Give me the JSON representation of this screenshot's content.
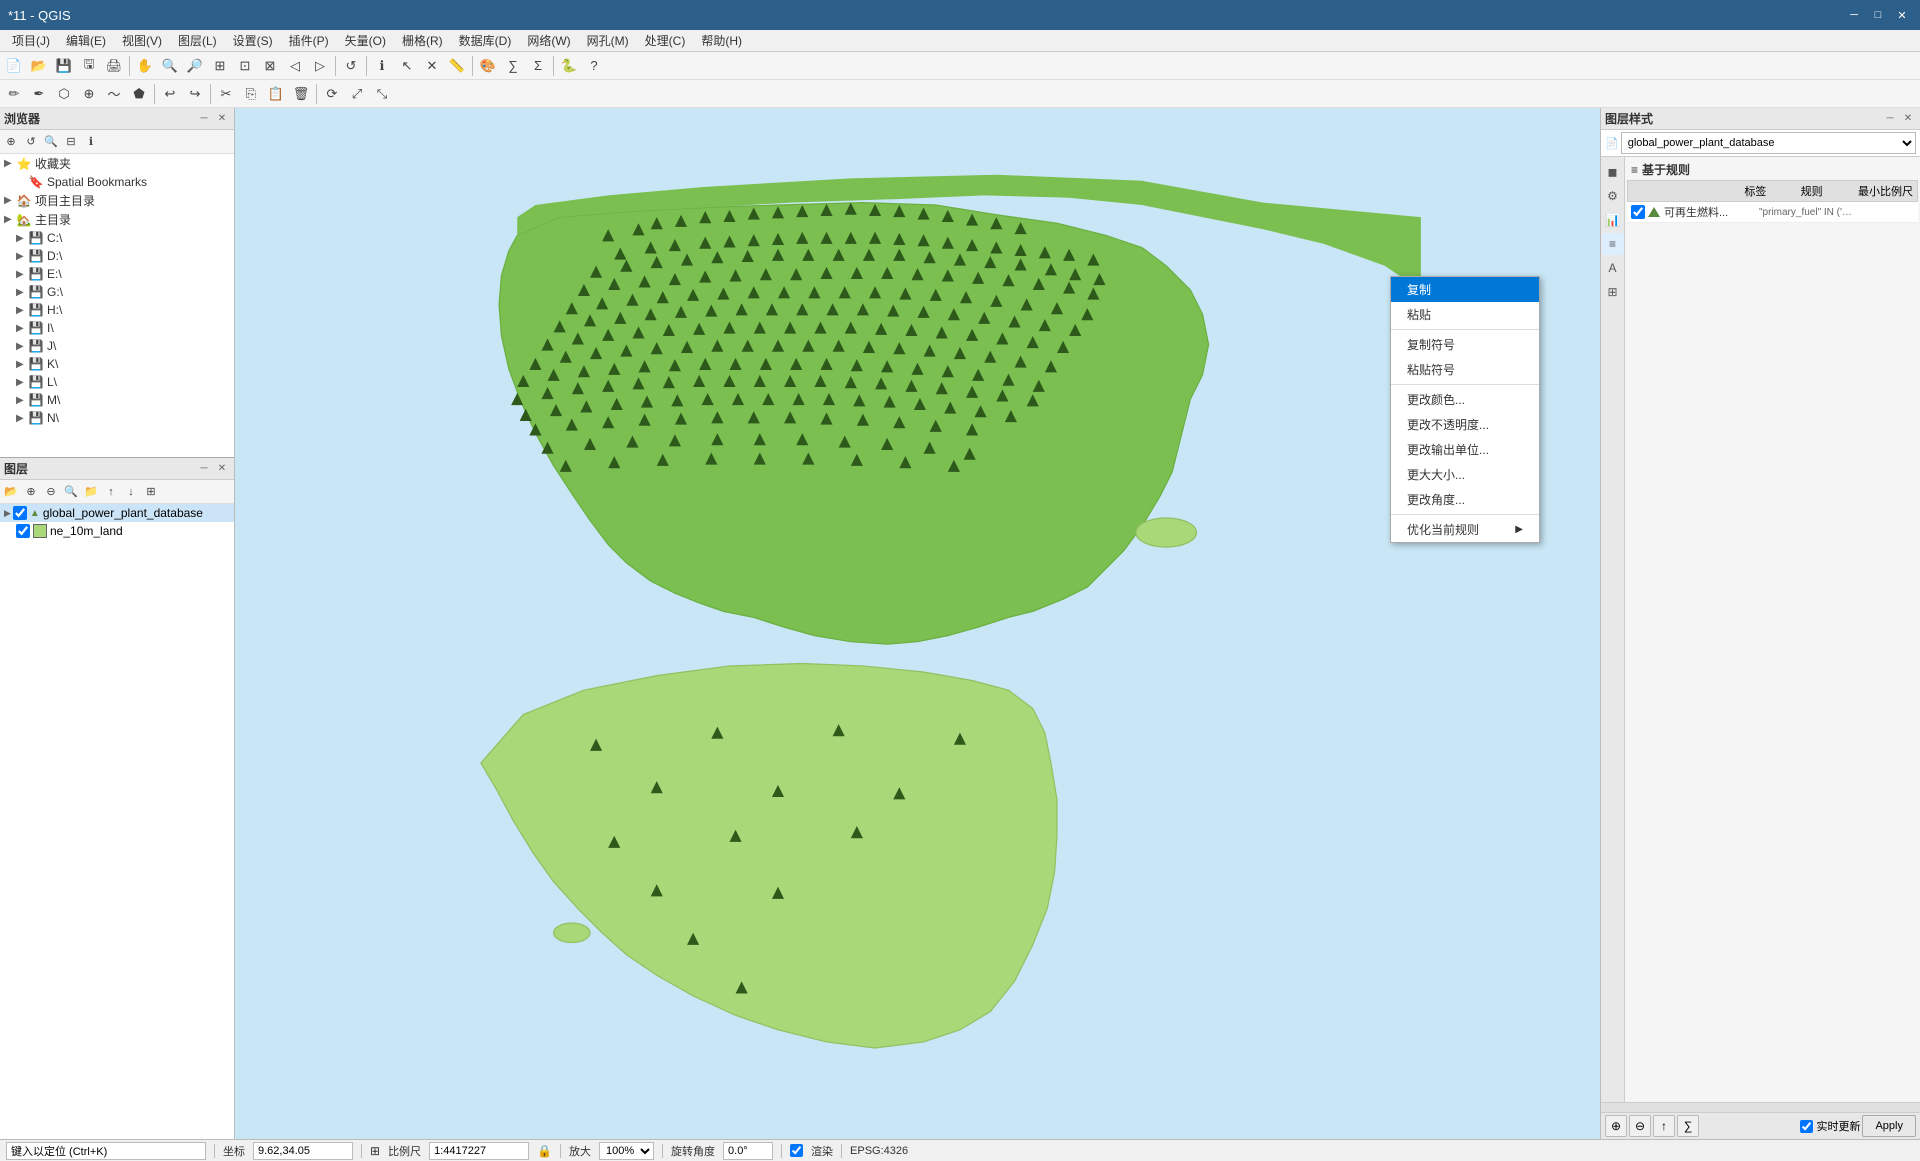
{
  "titlebar": {
    "title": "*11 - QGIS",
    "controls": [
      "minimize",
      "maximize",
      "close"
    ]
  },
  "menubar": {
    "items": [
      "项目(J)",
      "编辑(E)",
      "视图(V)",
      "图层(L)",
      "设置(S)",
      "插件(P)",
      "矢量(O)",
      "栅格(R)",
      "数据库(D)",
      "网络(W)",
      "网孔(M)",
      "处理(C)",
      "帮助(H)"
    ]
  },
  "browser_panel": {
    "title": "浏览器",
    "items": [
      {
        "label": "收藏夹",
        "indent": 0,
        "expandable": true
      },
      {
        "label": "Spatial Bookmarks",
        "indent": 1,
        "expandable": false
      },
      {
        "label": "项目主目录",
        "indent": 0,
        "expandable": true
      },
      {
        "label": "主目录",
        "indent": 0,
        "expandable": true
      },
      {
        "label": "C:\\",
        "indent": 1,
        "expandable": true
      },
      {
        "label": "D:\\",
        "indent": 1,
        "expandable": true
      },
      {
        "label": "E:\\",
        "indent": 1,
        "expandable": true
      },
      {
        "label": "G:\\",
        "indent": 1,
        "expandable": true
      },
      {
        "label": "H:\\",
        "indent": 1,
        "expandable": true
      },
      {
        "label": "I\\",
        "indent": 1,
        "expandable": true
      },
      {
        "label": "J\\",
        "indent": 1,
        "expandable": true
      },
      {
        "label": "K\\",
        "indent": 1,
        "expandable": true
      },
      {
        "label": "L\\",
        "indent": 1,
        "expandable": true
      },
      {
        "label": "M\\",
        "indent": 1,
        "expandable": true
      },
      {
        "label": "N\\",
        "indent": 1,
        "expandable": true
      }
    ]
  },
  "layers_panel": {
    "title": "图层",
    "layers": [
      {
        "label": "global_power_plant_database",
        "type": "vector",
        "checked": true,
        "selected": true
      },
      {
        "label": "ne_10m_land",
        "type": "polygon",
        "checked": true,
        "selected": false,
        "color": "#a8d878"
      }
    ]
  },
  "right_panel": {
    "title": "图层样式",
    "layer_select": "global_power_plant_database",
    "section_title": "基于规则",
    "columns": [
      "标签",
      "规则",
      "最小比例尺"
    ],
    "rules": [
      {
        "checked": true,
        "label": "可再生燃料...",
        "expr": "\"primary_fuel\" IN ('Biomass', '...",
        "minscale": ""
      }
    ]
  },
  "context_menu": {
    "items": [
      {
        "label": "复制",
        "highlighted": true
      },
      {
        "label": "粘贴",
        "highlighted": false
      },
      {
        "label": "复制符号",
        "highlighted": false
      },
      {
        "label": "粘贴符号",
        "highlighted": false,
        "sep_before": true
      },
      {
        "label": "更改颜色...",
        "highlighted": false,
        "sep_before": true
      },
      {
        "label": "更改不透明度...",
        "highlighted": false
      },
      {
        "label": "更改输出单位...",
        "highlighted": false
      },
      {
        "label": "更大大小...",
        "highlighted": false
      },
      {
        "label": "更改角度...",
        "highlighted": false
      },
      {
        "label": "优化当前规则",
        "highlighted": false,
        "has_arrow": true
      }
    ]
  },
  "statusbar": {
    "coord_label": "坐标",
    "coord_value": "9.62,34.05",
    "scale_label": "比例尺",
    "scale_value": "1:4417227",
    "lock_icon": "🔒",
    "zoom_label": "放大",
    "zoom_value": "100%",
    "rotation_label": "旋转角度",
    "rotation_value": "0.0°",
    "render_label": "渲染",
    "epsg_value": "EPSG:4326"
  },
  "style_bottom": {
    "realtime_label": "实时更新",
    "apply_label": "Apply"
  }
}
